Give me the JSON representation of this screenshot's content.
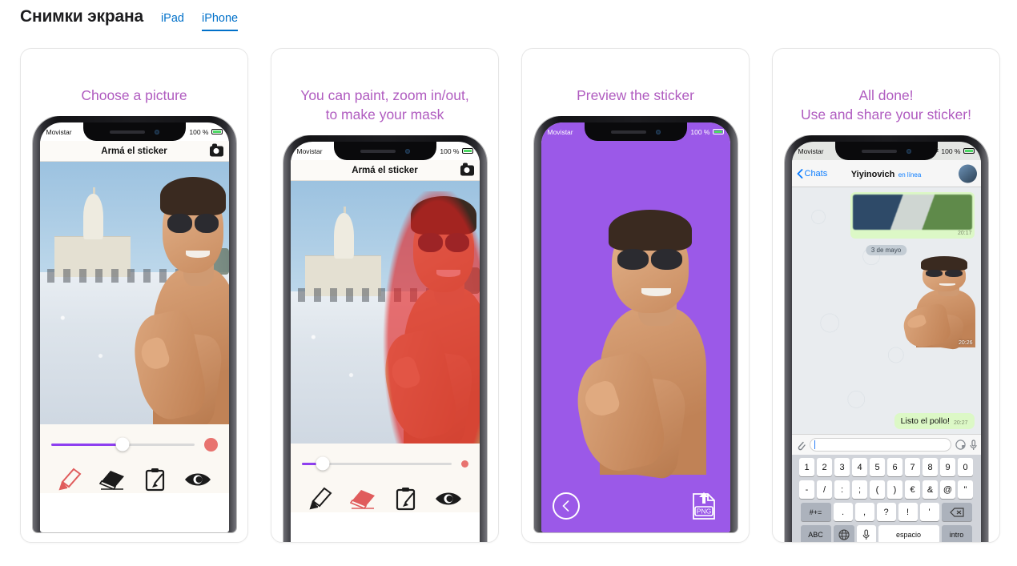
{
  "header": {
    "title": "Снимки экрана",
    "tabs": [
      {
        "label": "iPad",
        "active": false
      },
      {
        "label": "iPhone",
        "active": true
      }
    ]
  },
  "colors": {
    "accent_link": "#0070c9",
    "caption_purple": "#b05cc0",
    "sticker_background_purple": "#9b59e8",
    "slider_fill": "#8e3ff0",
    "brush_red": "#e8736f",
    "mask_red": "#e42020",
    "whatsapp_bubble_green": "#dcf8c6"
  },
  "screenshots": [
    {
      "caption": "Choose a picture",
      "status_bar": {
        "carrier": "Movistar",
        "battery": "100 %"
      },
      "app": {
        "nav_title": "Armá el sticker",
        "camera_icon": "camera-icon",
        "slider_value": 50,
        "brush_size_px": 17,
        "tools": [
          {
            "name": "marker-tool",
            "label": "Marker",
            "active": true
          },
          {
            "name": "eraser-tool",
            "label": "Eraser",
            "active": false
          },
          {
            "name": "clear-tool",
            "label": "Clear",
            "active": false
          },
          {
            "name": "preview-tool",
            "label": "Preview",
            "active": false
          }
        ]
      }
    },
    {
      "caption": "You can paint, zoom in/out,\nto make your mask",
      "status_bar": {
        "carrier": "Movistar",
        "battery": "100 %"
      },
      "app": {
        "nav_title": "Armá el sticker",
        "camera_icon": "camera-icon",
        "slider_value": 14,
        "brush_size_px": 9,
        "tools": [
          {
            "name": "marker-tool",
            "label": "Marker",
            "active": false
          },
          {
            "name": "eraser-tool",
            "label": "Eraser",
            "active": true
          },
          {
            "name": "clear-tool",
            "label": "Clear",
            "active": false
          },
          {
            "name": "preview-tool",
            "label": "Preview",
            "active": false
          }
        ]
      }
    },
    {
      "caption": "Preview the sticker",
      "status_bar": {
        "carrier": "Movistar",
        "battery": "100 %"
      },
      "app": {
        "back_button": "back-chevron-circle-icon",
        "export_button_label": "PNG"
      }
    },
    {
      "caption": "All done!\nUse and share your sticker!",
      "status_bar": {
        "carrier": "Movistar",
        "battery": "100 %"
      },
      "app": {
        "back_label": "Chats",
        "contact_name": "Yiyinovich",
        "contact_status": "en línea",
        "date_chip": "3 de mayo",
        "messages": [
          {
            "type": "image",
            "time": "20:17"
          },
          {
            "type": "sticker",
            "time": "20:26"
          },
          {
            "type": "text",
            "text": "Listo el pollo!",
            "time": "20:27"
          }
        ],
        "input_placeholder": "",
        "keyboard": {
          "rows": [
            [
              "1",
              "2",
              "3",
              "4",
              "5",
              "6",
              "7",
              "8",
              "9",
              "0"
            ],
            [
              "-",
              "/",
              ":",
              ";",
              "(",
              ")",
              "€",
              "&",
              "@",
              "\""
            ],
            [
              "#+=",
              ".",
              ",",
              "?",
              "!",
              "'",
              "⌫"
            ],
            [
              "ABC",
              "globe",
              "mic",
              "espacio",
              "intro"
            ]
          ],
          "space_label": "espacio",
          "return_label": "intro",
          "abc_label": "ABC",
          "symbols_label": "#+="
        }
      }
    }
  ]
}
